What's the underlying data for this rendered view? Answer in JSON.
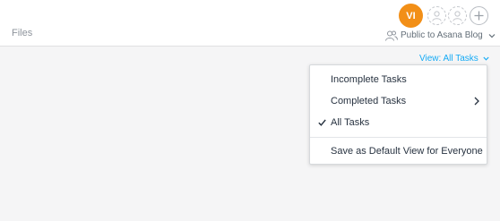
{
  "header": {
    "tab_files": "Files",
    "avatar_initials": "VI",
    "avatar_color": "#f28f17",
    "privacy_label": "Public to Asana Blog",
    "privacy_icon": "people-icon",
    "add_member_icon": "plus-icon"
  },
  "view": {
    "toggle_label": "View: All Tasks",
    "accent_color": "#14aaf5"
  },
  "menu": {
    "items": [
      {
        "label": "Incomplete Tasks",
        "checked": false,
        "has_submenu": false
      },
      {
        "label": "Completed Tasks",
        "checked": false,
        "has_submenu": true
      },
      {
        "label": "All Tasks",
        "checked": true,
        "has_submenu": false
      },
      {
        "label": "Save as Default View for Everyone",
        "checked": false,
        "has_submenu": false
      }
    ]
  }
}
